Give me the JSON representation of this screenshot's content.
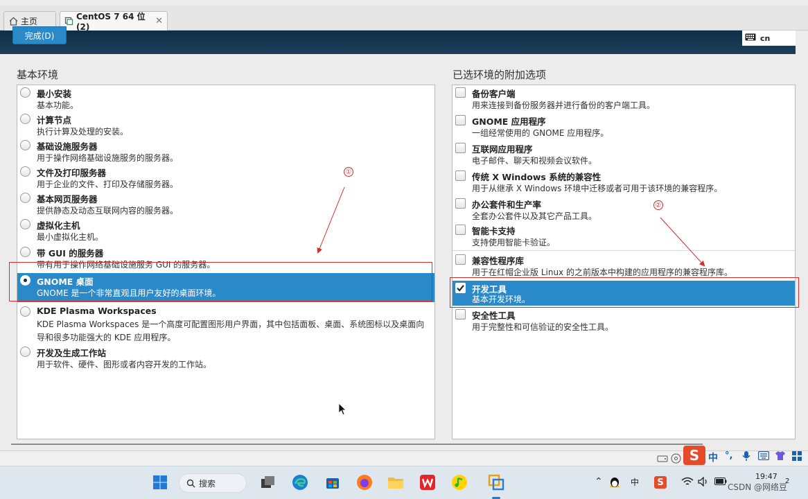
{
  "tabs": [
    {
      "label": "主页",
      "icon": "home-icon"
    },
    {
      "label": "CentOS 7 64 位 (2)",
      "icon": "vm-icon",
      "close": "✕"
    }
  ],
  "header": {
    "done_label": "完成(D)",
    "keyboard_layout": "cn"
  },
  "left_panel": {
    "title": "基本环境",
    "items": [
      {
        "name": "最小安装",
        "desc": "基本功能。"
      },
      {
        "name": "计算节点",
        "desc": "执行计算及处理的安装。"
      },
      {
        "name": "基础设施服务器",
        "desc": "用于操作网络基础设施服务的服务器。"
      },
      {
        "name": "文件及打印服务器",
        "desc": "用于企业的文件、打印及存储服务器。"
      },
      {
        "name": "基本网页服务器",
        "desc": "提供静态及动态互联网内容的服务器。"
      },
      {
        "name": "虚拟化主机",
        "desc": "最小虚拟化主机。"
      },
      {
        "name": "带 GUI 的服务器",
        "desc": "带有用于操作网络基础设施服务 GUI 的服务器。"
      },
      {
        "name": "GNOME 桌面",
        "desc": "GNOME 是一个非常直观且用户友好的桌面环境。"
      },
      {
        "name": "KDE Plasma Workspaces",
        "desc": "KDE Plasma Workspaces 是一个高度可配置图形用户界面，其中包括面板、桌面、系统图标以及桌面向导和很多功能强大的 KDE 应用程序。"
      },
      {
        "name": "开发及生成工作站",
        "desc": "用于软件、硬件、图形或者内容开发的工作站。"
      }
    ]
  },
  "right_panel": {
    "title": "已选环境的附加选项",
    "items": [
      {
        "name": "备份客户端",
        "desc": "用来连接到备份服务器并进行备份的客户端工具。"
      },
      {
        "name": "GNOME 应用程序",
        "desc": "一组经常使用的 GNOME 应用程序。"
      },
      {
        "name": "互联网应用程序",
        "desc": "电子邮件、聊天和视频会议软件。"
      },
      {
        "name": "传统 X Windows 系统的兼容性",
        "desc": "用于从继承 X Windows 环境中迁移或者可用于该环境的兼容程序。"
      },
      {
        "name": "办公套件和生产率",
        "desc": "全套办公套件以及其它产品工具。"
      },
      {
        "name": "智能卡支持",
        "desc": "支持使用智能卡验证。"
      },
      {
        "name": "兼容性程序库",
        "desc": "用于在红帽企业版 Linux 的之前版本中构建的应用程序的兼容程序库。"
      },
      {
        "name": "开发工具",
        "desc": "基本开发环境。"
      },
      {
        "name": "安全性工具",
        "desc": "用于完整性和可信验证的安全性工具。"
      }
    ]
  },
  "annotations": [
    {
      "label": "①"
    },
    {
      "label": "②"
    }
  ],
  "taskbar": {
    "search_label": "搜索",
    "ime_lang": "中",
    "ime_tray_lang": "中",
    "ime_punct": "°,",
    "clock_time": "19:47",
    "notification_count": "2"
  },
  "watermark": "CSDN @网络豆",
  "colors": {
    "selection": "#2a89c9",
    "header": "#1d3e5a",
    "annotation": "#d62b2b"
  }
}
